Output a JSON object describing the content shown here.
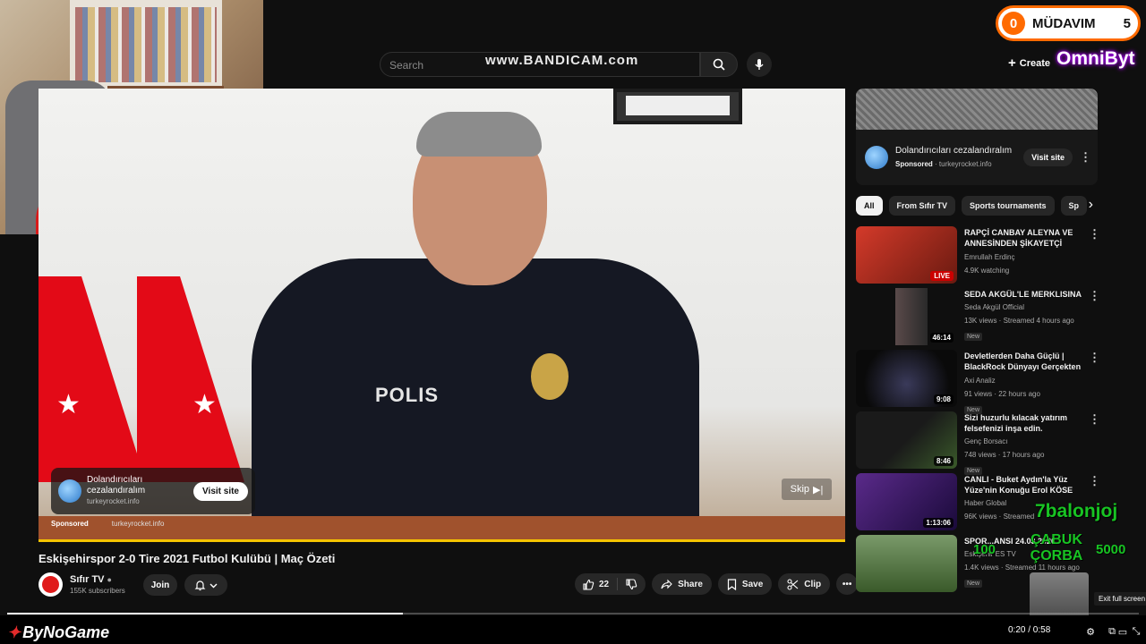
{
  "topbar": {
    "search_placeholder": "Search",
    "watermark": "www.BANDICAM.com",
    "create_label": "Create"
  },
  "overlay": {
    "badge_count": "0",
    "badge_label": "MÜDAVIM",
    "badge_number": "5",
    "omni": "OmniByt",
    "balon": "7balonjoj",
    "corba": "ÇABUK ÇORBA",
    "num_left": "100",
    "num_right": "5000",
    "bynogame": "ByNoGame"
  },
  "video": {
    "polis_text": "POLIS",
    "skip_label": "Skip",
    "ad_title": "Dolandırıcıları cezalandıralım",
    "ad_domain": "turkeyrocket.info",
    "ad_visit": "Visit site",
    "sponsored": "Sponsored",
    "sponsored_domain": "turkeyrocket.info",
    "title": "Eskişehirspor 2-0 Tire 2021 Futbol Kulübü | Maç Özeti",
    "progress": 0.35
  },
  "channel": {
    "name": "Sıfır TV",
    "subscribers": "155K subscribers",
    "join_label": "Join"
  },
  "actions": {
    "likes": "22",
    "share": "Share",
    "save": "Save",
    "clip": "Clip"
  },
  "sidebar": {
    "ad": {
      "title": "Dolandırıcıları cezalandıralım",
      "sponsored": "Sponsored",
      "domain": "turkeyrocket.info",
      "visit": "Visit site"
    },
    "chips": [
      "All",
      "From Sıfır TV",
      "Sports tournaments",
      "Sp"
    ],
    "items": [
      {
        "title": "RAPÇİ CANBAY ALEYNA VE ANNESİNDEN ŞİKAYETÇİ OLDU",
        "channel": "Emrullah Erdinç",
        "meta": "4.9K watching",
        "badge": "LIVE",
        "new": "",
        "thumb": "#7a2a1a"
      },
      {
        "title": "SEDA AKGÜL'LE MERKLISINA",
        "channel": "Seda Akgül Official",
        "meta": "13K views · Streamed 4 hours ago",
        "badge": "46:14",
        "new": "New",
        "thumb": "#3b3b3b"
      },
      {
        "title": "Devletlerden Daha Güçlü | BlackRock Dünyayı Gerçekten ...",
        "channel": "Axi Analiz",
        "meta": "91 views · 22 hours ago",
        "badge": "9:08",
        "new": "New",
        "thumb": "#1a1a1a"
      },
      {
        "title": "Sizi huzurlu kılacak yatırım felsefenizi inşa edin.",
        "channel": "Genç Borsacı",
        "meta": "748 views · 17 hours ago",
        "badge": "8:46",
        "new": "New",
        "thumb": "#2a3a1a"
      },
      {
        "title": "CANLI - Buket Aydın'la Yüz Yüze'nin Konuğu Erol KÖSE",
        "channel": "Haber Global",
        "meta": "96K views · Streamed",
        "badge": "1:13:06",
        "new": "",
        "thumb": "#2a1a4a"
      },
      {
        "title": "SPOR...ANSI 24.03.2026",
        "channel": "Eskişehir ES TV",
        "meta": "1.4K views · Streamed 11 hours ago",
        "badge": "",
        "new": "New",
        "thumb": "#3a5a2a"
      }
    ]
  },
  "player": {
    "time": "0:20 / 0:58",
    "tooltip": "Exit full screen",
    "progress": 0.35
  }
}
